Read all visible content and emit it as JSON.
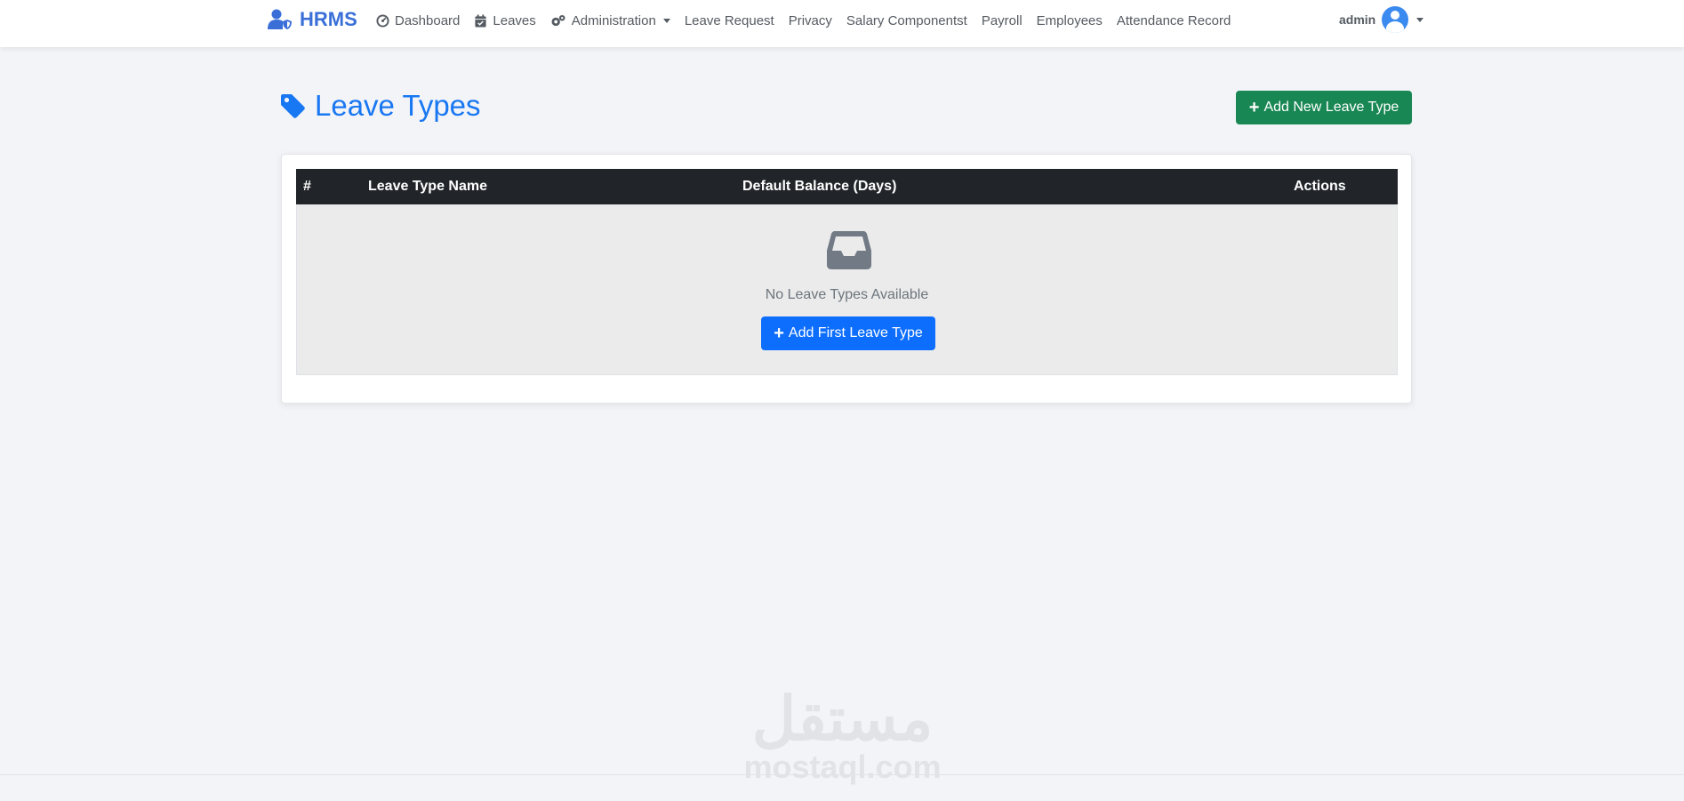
{
  "navbar": {
    "brand": "HRMS",
    "links": {
      "dashboard": "Dashboard",
      "leaves": "Leaves",
      "administration": "Administration",
      "leave_request": "Leave Request",
      "privacy": "Privacy",
      "salary_components": "Salary Componentst",
      "payroll": "Payroll",
      "employees": "Employees",
      "attendance_record": "Attendance Record"
    },
    "user": "admin"
  },
  "header": {
    "title": "Leave Types",
    "add_button": "Add New Leave Type"
  },
  "table": {
    "columns": [
      "#",
      "Leave Type Name",
      "Default Balance (Days)",
      "Actions"
    ],
    "empty_message": "No Leave Types Available",
    "empty_button": "Add First Leave Type"
  },
  "watermark": {
    "arabic": "مستقل",
    "latin": "mostaql.com"
  },
  "colors": {
    "brand": "#3a6fd8",
    "title": "#1877f2",
    "success": "#198754",
    "primary": "#0d6efd",
    "table_header": "#212529"
  }
}
